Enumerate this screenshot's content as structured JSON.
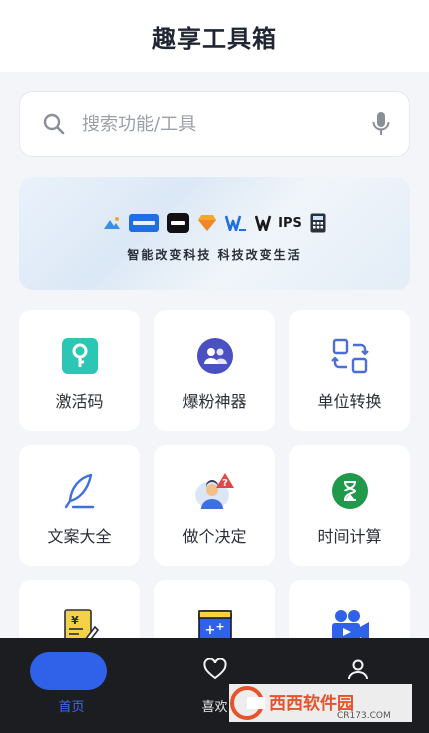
{
  "header": {
    "title": "趣享工具箱"
  },
  "search": {
    "placeholder": "搜索功能/工具"
  },
  "banner": {
    "tagline": "智能改变科技  科技改变生活",
    "logo_wps_text": "IPS"
  },
  "tools": [
    {
      "label": "激活码",
      "icon": "key-icon",
      "color": "#2cc6b4"
    },
    {
      "label": "爆粉神器",
      "icon": "users-icon",
      "color": "#4a4fc1"
    },
    {
      "label": "单位转换",
      "icon": "convert-icon",
      "color": "#4b6fd6"
    },
    {
      "label": "文案大全",
      "icon": "feather-icon",
      "color": "#3d6fe0"
    },
    {
      "label": "做个决定",
      "icon": "decision-icon",
      "color": "#e04848"
    },
    {
      "label": "时间计算",
      "icon": "hourglass-icon",
      "color": "#1f9a4b"
    },
    {
      "label": "",
      "icon": "document-yen-icon",
      "color": "#e6c22b"
    },
    {
      "label": "",
      "icon": "calculator-plus-icon",
      "color": "#2f62e8"
    },
    {
      "label": "",
      "icon": "video-camera-icon",
      "color": "#2f62e8"
    }
  ],
  "tabbar": {
    "items": [
      {
        "label": "首页",
        "icon": "home-icon",
        "active": true
      },
      {
        "label": "喜欢",
        "icon": "heart-icon",
        "active": false
      },
      {
        "label": "",
        "icon": "profile-icon",
        "active": false
      }
    ],
    "accent": "#2f62e8"
  },
  "watermark": {
    "text": "西西软件园",
    "sub": "CR173.COM"
  }
}
